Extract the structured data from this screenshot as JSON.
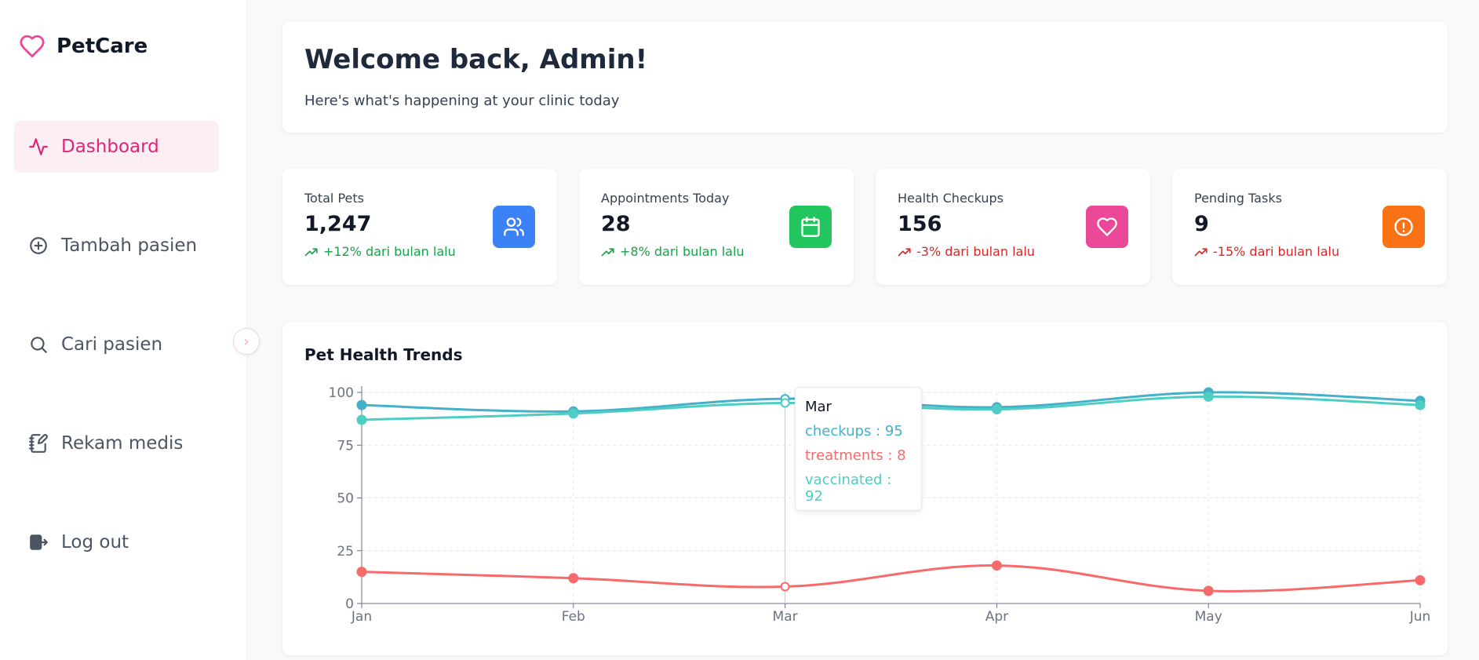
{
  "app": {
    "name": "PetCare"
  },
  "sidebar": {
    "items": [
      {
        "label": "Dashboard",
        "icon": "activity-icon",
        "active": true
      },
      {
        "label": "Tambah pasien",
        "icon": "plus-circle-icon"
      },
      {
        "label": "Cari pasien",
        "icon": "search-icon"
      },
      {
        "label": "Rekam medis",
        "icon": "notebook-pen-icon"
      },
      {
        "label": "Log out",
        "icon": "logout-icon"
      }
    ]
  },
  "welcome": {
    "title": "Welcome back, Admin!",
    "subtitle": "Here's what's happening at your clinic today"
  },
  "stats": [
    {
      "title": "Total Pets",
      "value": "1,247",
      "trend": "+12% dari bulan lalu",
      "direction": "up",
      "icon": "users-icon",
      "color": "#3b82f6"
    },
    {
      "title": "Appointments Today",
      "value": "28",
      "trend": "+8% dari bulan lalu",
      "direction": "up",
      "icon": "calendar-icon",
      "color": "#22c55e"
    },
    {
      "title": "Health Checkups",
      "value": "156",
      "trend": "-3% dari bulan lalu",
      "direction": "down",
      "icon": "heart-icon",
      "color": "#ec4899"
    },
    {
      "title": "Pending Tasks",
      "value": "9",
      "trend": "-15% dari bulan lalu",
      "direction": "down",
      "icon": "alert-circle-icon",
      "color": "#f97316"
    }
  ],
  "colors": {
    "up": "#16a34a",
    "down": "#dc2626",
    "accent": "#db2777"
  },
  "chart_data": {
    "type": "line",
    "title": "Pet Health Trends",
    "categories": [
      "Jan",
      "Feb",
      "Mar",
      "Apr",
      "May",
      "Jun"
    ],
    "ylim": [
      0,
      100
    ],
    "yticks": [
      0,
      25,
      50,
      75,
      100
    ],
    "grid": true,
    "series": [
      {
        "name": "checkups",
        "color": "#45b0c9",
        "values": [
          94,
          91,
          97,
          93,
          100,
          96
        ]
      },
      {
        "name": "treatments",
        "color": "#f66a6a",
        "values": [
          15,
          12,
          8,
          18,
          6,
          11
        ]
      },
      {
        "name": "vaccinated",
        "color": "#4ecdc4",
        "values": [
          87,
          90,
          95,
          92,
          98,
          94
        ]
      }
    ],
    "tooltip": {
      "label": "Mar",
      "lines": [
        "checkups : 95",
        "treatments : 8",
        "vaccinated : 92"
      ]
    }
  }
}
